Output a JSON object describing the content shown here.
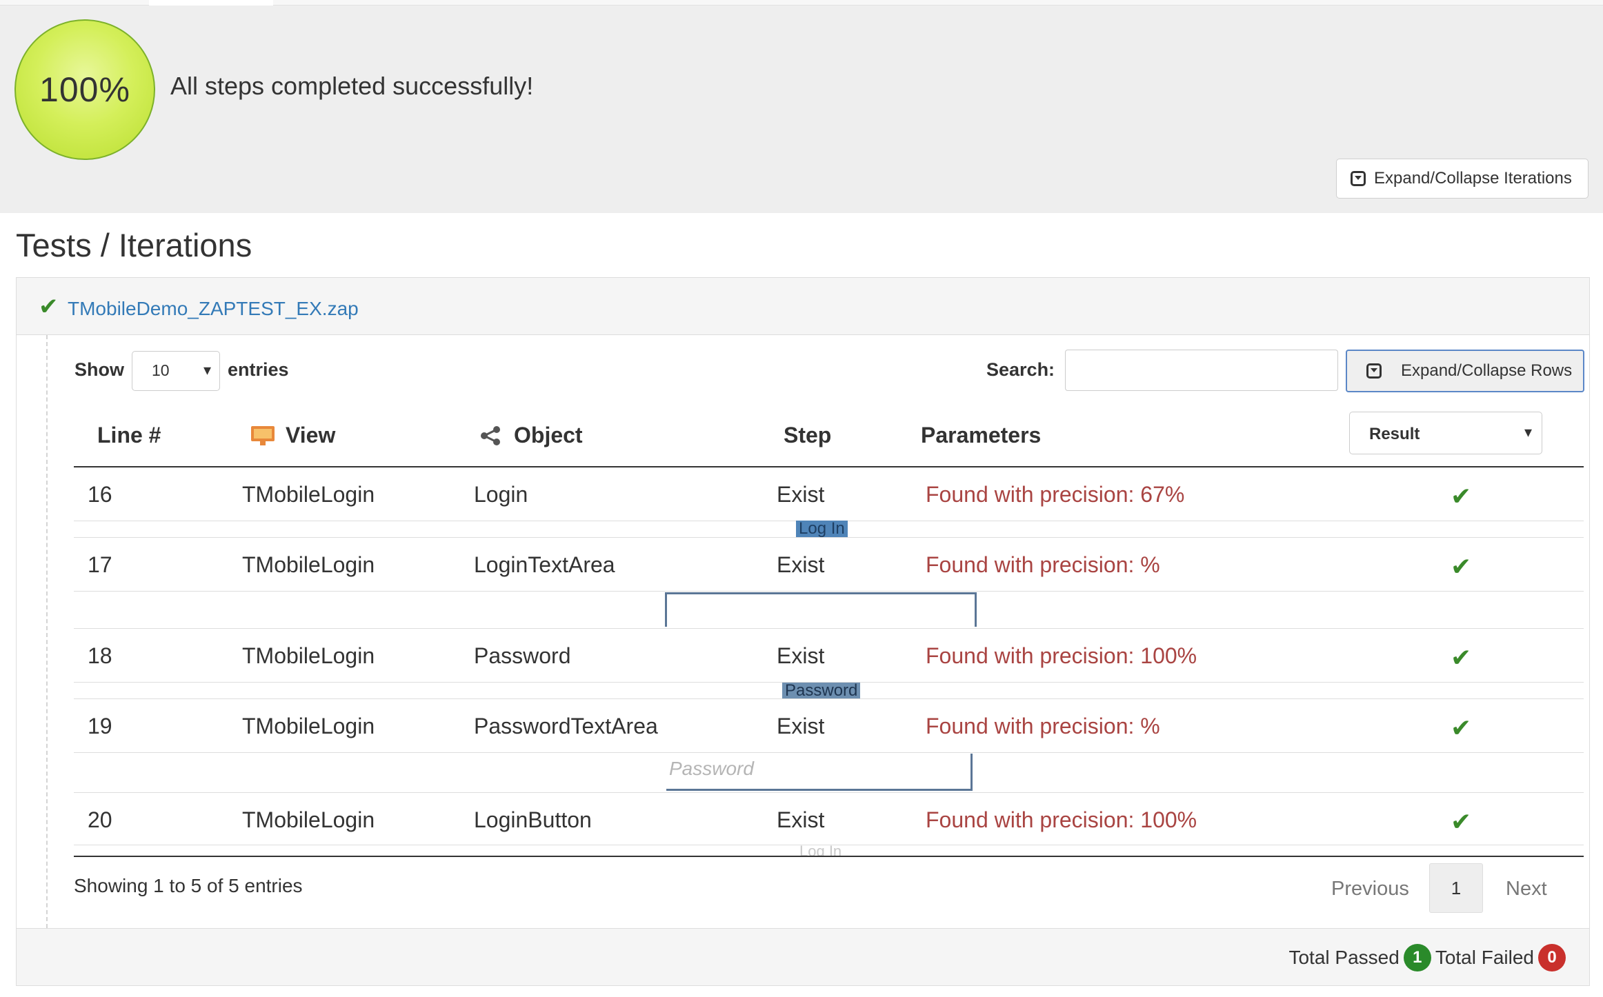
{
  "summary": {
    "progress_label": "100%",
    "progress": 1.0,
    "message": "All steps completed successfully!",
    "expand_iterations_label": "Expand/Collapse Iterations"
  },
  "section_title": "Tests / Iterations",
  "panel": {
    "file_name": "TMobileDemo_ZAPTEST_EX.zap",
    "status_icon": "check-icon"
  },
  "controls": {
    "show_label": "Show",
    "page_size": "10",
    "entries_label": "entries",
    "search_label": "Search:",
    "search_value": "",
    "expand_rows_label": "Expand/Collapse Rows"
  },
  "table": {
    "headers": {
      "line": "Line #",
      "view": "View",
      "object": "Object",
      "step": "Step",
      "parameters": "Parameters",
      "result_filter": "Result"
    },
    "rows": [
      {
        "line": "16",
        "view": "TMobileLogin",
        "object": "Login",
        "step": "Exist",
        "parameters": "Found with precision: 67%",
        "result": "passed",
        "snippet": "Log In"
      },
      {
        "line": "17",
        "view": "TMobileLogin",
        "object": "LoginTextArea",
        "step": "Exist",
        "parameters": "Found with precision: %",
        "result": "passed",
        "snippet": ""
      },
      {
        "line": "18",
        "view": "TMobileLogin",
        "object": "Password",
        "step": "Exist",
        "parameters": "Found with precision: 100%",
        "result": "passed",
        "snippet": "Password"
      },
      {
        "line": "19",
        "view": "TMobileLogin",
        "object": "PasswordTextArea",
        "step": "Exist",
        "parameters": "Found with precision: %",
        "result": "passed",
        "snippet": "Password"
      },
      {
        "line": "20",
        "view": "TMobileLogin",
        "object": "LoginButton",
        "step": "Exist",
        "parameters": "Found with precision: 100%",
        "result": "passed",
        "snippet": "Log In"
      }
    ]
  },
  "pagination": {
    "info": "Showing 1 to 5 of 5 entries",
    "previous": "Previous",
    "current_page": "1",
    "next": "Next"
  },
  "totals": {
    "passed_label": "Total Passed",
    "passed_count": "1",
    "failed_label": "Total Failed",
    "failed_count": "0"
  },
  "colors": {
    "pass": "#3a8a2a",
    "fail": "#c9302c",
    "parameter_text": "#a94442",
    "link": "#337ab7"
  }
}
